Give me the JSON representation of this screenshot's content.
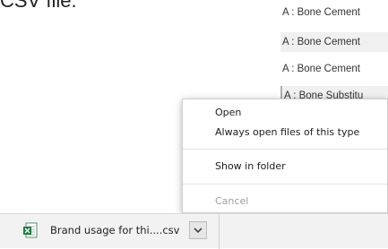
{
  "heading_fragment": "CSV file.",
  "bg_rows": [
    "A : Bone Cement",
    "A : Bone Cement",
    "A : Bone Cement",
    "A : Bone Substitu"
  ],
  "context_menu": {
    "items": [
      {
        "label": "Open",
        "enabled": true
      },
      {
        "label": "Always open files of this type",
        "enabled": true
      },
      {
        "label": "Show in folder",
        "enabled": true
      },
      {
        "label": "Cancel",
        "enabled": false
      }
    ]
  },
  "download_bar": {
    "file_name": "Brand usage for thi....csv",
    "file_icon": "spreadsheet-icon",
    "menu_icon": "chevron-down-icon"
  },
  "colors": {
    "menu_text": "#202020",
    "disabled_text": "#a0a0a0",
    "bar_background": "#f2f2f2",
    "spreadsheet_green": "#1d7a3f"
  }
}
